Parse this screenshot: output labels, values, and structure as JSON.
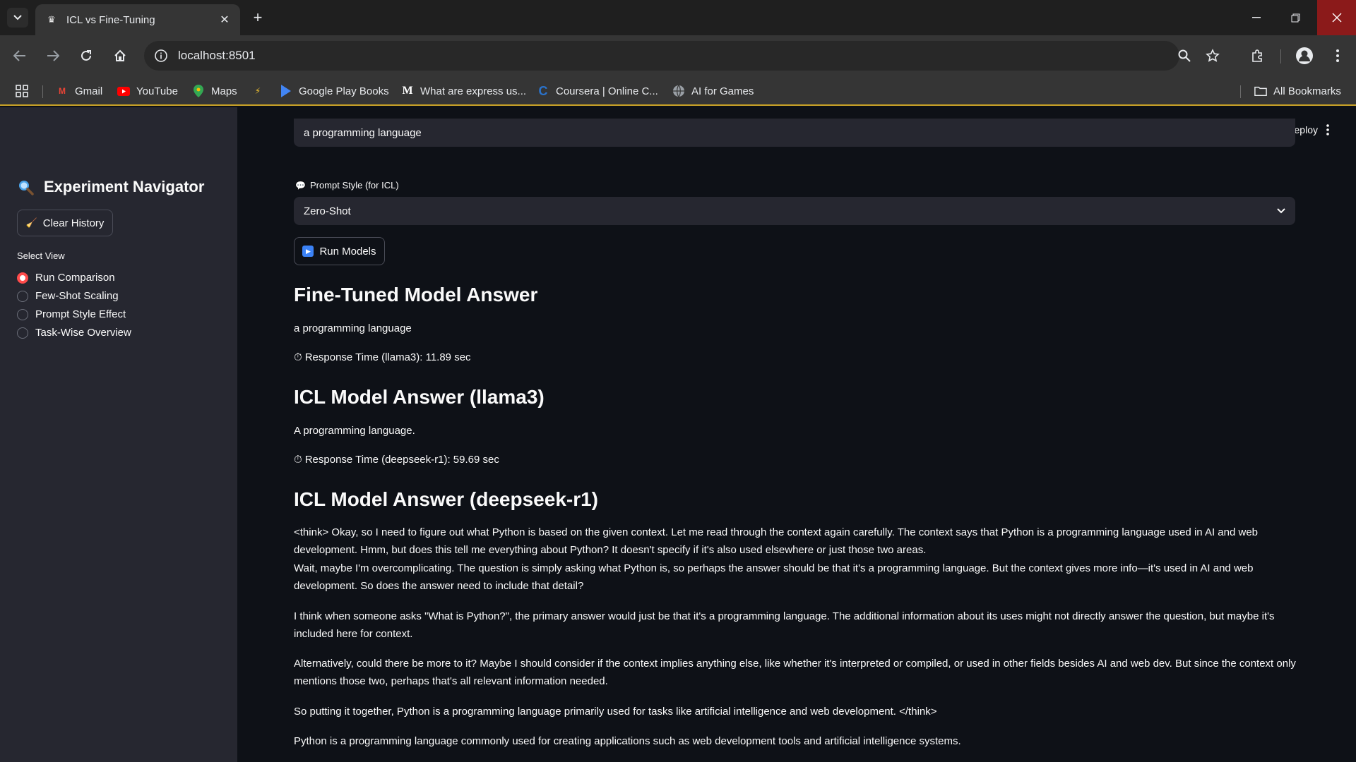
{
  "browser": {
    "tab_title": "ICL vs Fine-Tuning",
    "url": "localhost:8501",
    "bookmarks": [
      {
        "label": "Gmail",
        "icon": "gmail-icon"
      },
      {
        "label": "YouTube",
        "icon": "youtube-icon"
      },
      {
        "label": "Maps",
        "icon": "maps-icon"
      },
      {
        "label": "Google Play Books",
        "icon": "play-books-icon"
      },
      {
        "label": "What are express us...",
        "icon": "medium-icon"
      },
      {
        "label": "Coursera | Online C...",
        "icon": "coursera-icon"
      },
      {
        "label": "AI for Games",
        "icon": "globe-icon"
      }
    ],
    "all_bookmarks": "All Bookmarks"
  },
  "header": {
    "deploy_label": "Deploy"
  },
  "sidebar": {
    "title": "Experiment Navigator",
    "clear_button": "Clear History",
    "view_label": "Select View",
    "options": [
      "Run Comparison",
      "Few-Shot Scaling",
      "Prompt Style Effect",
      "Task-Wise Overview"
    ],
    "selected_index": 0
  },
  "main": {
    "context_value": "a programming language",
    "prompt_style_label": "Prompt Style (for ICL)",
    "prompt_style_value": "Zero-Shot",
    "run_button": "Run Models",
    "ft_heading": "Fine-Tuned Model Answer",
    "ft_answer": "a programming language",
    "ft_time": "Response Time (llama3): 11.89 sec",
    "icl1_heading": "ICL Model Answer (llama3)",
    "icl1_answer": "A programming language.",
    "icl1_time": "Response Time (deepseek-r1): 59.69 sec",
    "icl2_heading": "ICL Model Answer (deepseek-r1)",
    "icl2_paragraphs": [
      "<think> Okay, so I need to figure out what Python is based on the given context. Let me read through the context again carefully. The context says that Python is a programming language used in AI and web development. Hmm, but does this tell me everything about Python? It doesn't specify if it's also used elsewhere or just those two areas.",
      "Wait, maybe I'm overcomplicating. The question is simply asking what Python is, so perhaps the answer should be that it's a programming language. But the context gives more info—it's used in AI and web development. So does the answer need to include that detail?",
      "I think when someone asks \"What is Python?\", the primary answer would just be that it's a programming language. The additional information about its uses might not directly answer the question, but maybe it's included here for context.",
      "Alternatively, could there be more to it? Maybe I should consider if the context implies anything else, like whether it's interpreted or compiled, or used in other fields besides AI and web dev. But since the context only mentions those two, perhaps that's all relevant information needed.",
      "So putting it together, Python is a programming language primarily used for tasks like artificial intelligence and web development. </think>",
      "Python is a programming language commonly used for creating applications such as web development tools and artificial intelligence systems."
    ]
  }
}
